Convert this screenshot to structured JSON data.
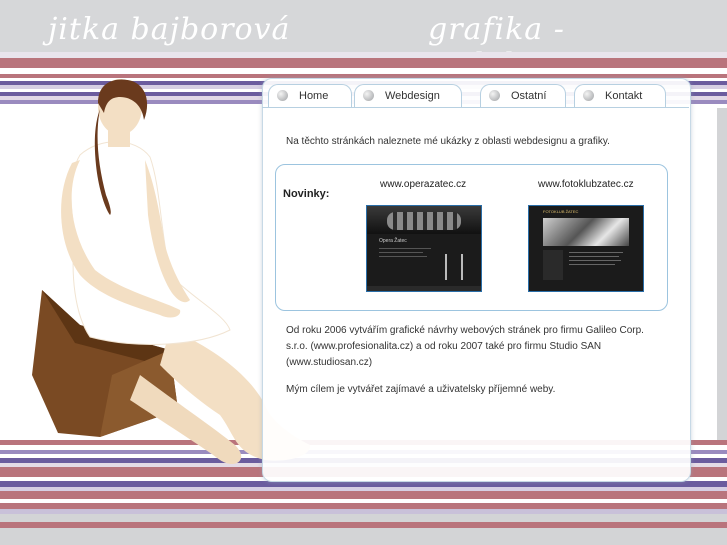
{
  "header": {
    "name_text": "jitka bajborová",
    "tagline_text": "grafika - webdesign"
  },
  "nav": {
    "tabs": [
      {
        "label": "Home"
      },
      {
        "label": "Webdesign"
      },
      {
        "label": "Ostatní"
      },
      {
        "label": "Kontakt"
      }
    ]
  },
  "main": {
    "intro": "Na těchto stránkách naleznete mé ukázky z oblasti webdesignu a grafiky.",
    "news_label": "Novinky:",
    "news": [
      {
        "site": "www.operazatec.cz",
        "thumb_title": "Opera Žatec"
      },
      {
        "site": "www.fotoklubzatec.cz",
        "thumb_title": "FOTOKLUB ŽATEC"
      }
    ],
    "para1_line1": "Od roku 2006 vytvářím grafické návrhy webových stránek pro firmu Galileo Corp.",
    "para1_line2": "s.r.o. (www.profesionalita.cz) a od roku 2007 také pro firmu Studio SAN",
    "para1_line3": "(www.studiosan.cz)",
    "para2": "Mým cílem je vytvářet zajímavé a uživatelsky příjemné weby."
  },
  "colors": {
    "stripe_rose": "#b9747c",
    "stripe_purple": "#6b5c9e",
    "stripe_light": "#c9c1d9",
    "panel_border": "#9cc4df"
  },
  "icons": {
    "tab_bullet": "grey-circle-bullet-icon"
  }
}
